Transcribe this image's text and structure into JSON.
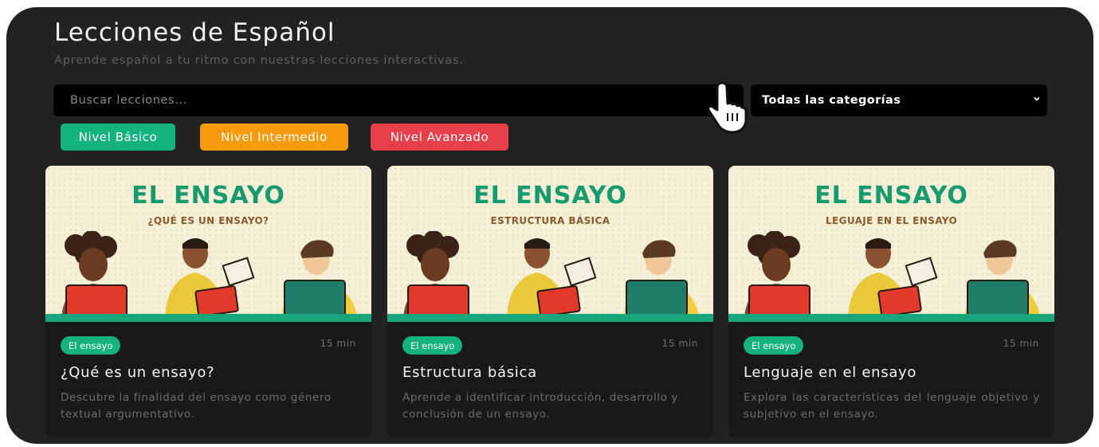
{
  "header": {
    "title": "Lecciones de Español",
    "subtitle": "Aprende español a tu ritmo con nuestras lecciones interactivas."
  },
  "search": {
    "placeholder": "Buscar lecciones..."
  },
  "category_select": {
    "selected": "Todas las categorías"
  },
  "levels": [
    {
      "label": "Nivel Básico",
      "color": "#14b27c"
    },
    {
      "label": "Nivel Intermedio",
      "color": "#f79a0e"
    },
    {
      "label": "Nivel Avanzado",
      "color": "#e8404a"
    }
  ],
  "cards": [
    {
      "thumb_title": "EL ENSAYO",
      "thumb_subtitle": "¿QUÉ ES UN ENSAYO?",
      "tag": "El ensayo",
      "duration": "15 min",
      "title": "¿Qué es un ensayo?",
      "description": "Descubre la finalidad del ensayo como género textual argumentativo."
    },
    {
      "thumb_title": "EL ENSAYO",
      "thumb_subtitle": "ESTRUCTURA BÁSICA",
      "tag": "El ensayo",
      "duration": "15 min",
      "title": "Estructura básica",
      "description": "Aprende a identificar introducción, desarrollo y conclusión de un ensayo."
    },
    {
      "thumb_title": "EL ENSAYO",
      "thumb_subtitle": "LEGUAJE EN EL ENSAYO",
      "tag": "El ensayo",
      "duration": "15 min",
      "title": "Lenguaje en el ensayo",
      "description": "Explora las características del lenguaje objetivo y subjetivo en el ensayo."
    }
  ],
  "colors": {
    "background": "#222222",
    "card": "#191919",
    "accent": "#15b27e",
    "thumb_bg": "#f7f0d8"
  },
  "icons": [
    "chevron-down-icon",
    "hand-pointer-cursor-icon"
  ]
}
